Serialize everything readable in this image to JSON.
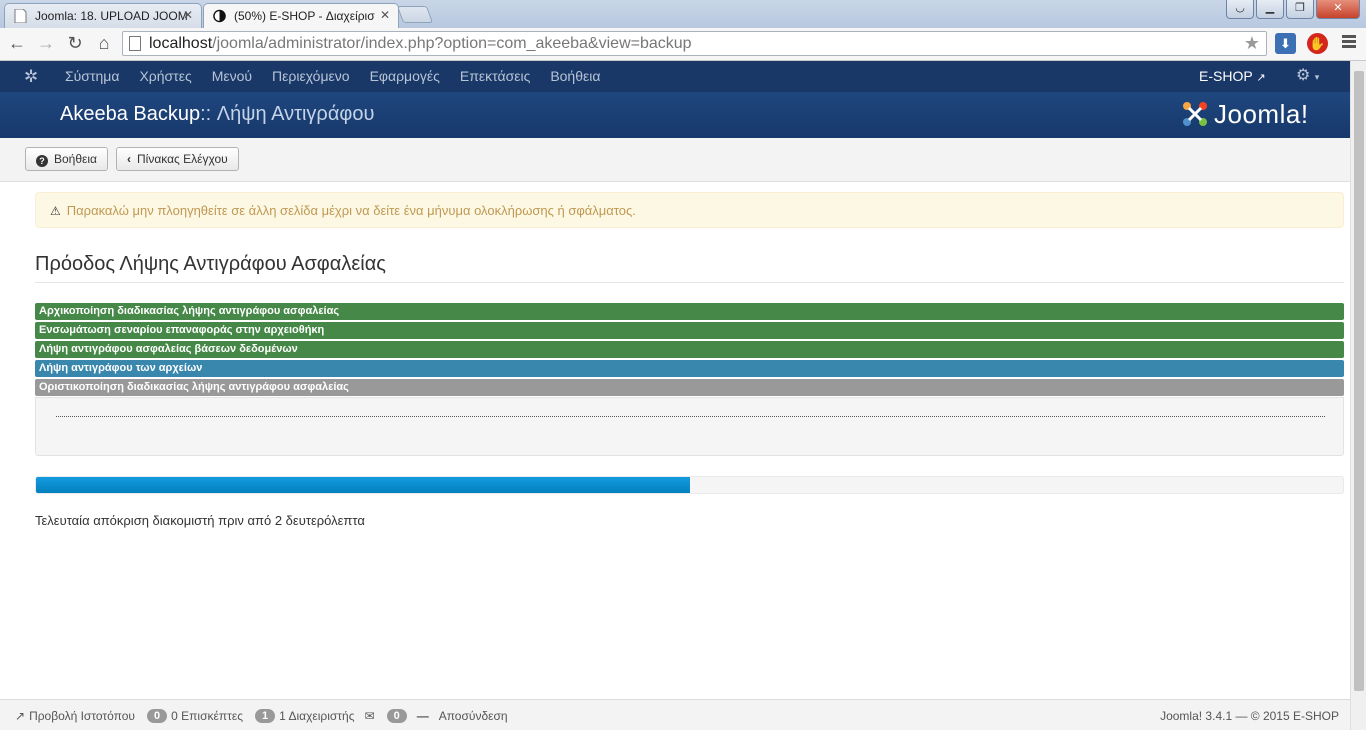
{
  "browser": {
    "tabs": [
      {
        "title": "Joomla: 18. UPLOAD JOOM",
        "icon": "page-icon"
      },
      {
        "title": "(50%) E-SHOP - Διαχείρισ",
        "icon": "half-circle-icon"
      }
    ],
    "url_host": "localhost",
    "url_path": "/joomla/administrator/index.php?option=com_akeeba&view=backup"
  },
  "admin_nav": {
    "menu": [
      "Σύστημα",
      "Χρήστες",
      "Μενού",
      "Περιεχόμενο",
      "Εφαρμογές",
      "Επεκτάσεις",
      "Βοήθεια"
    ],
    "site_name": "E-SHOP"
  },
  "header": {
    "title_main": "Akeeba Backup",
    "title_sep": "::",
    "title_sub": "Λήψη Αντιγράφου",
    "logo_text": "Joomla!"
  },
  "toolbar": {
    "help_label": "Βοήθεια",
    "control_panel_label": "Πίνακας Ελέγχου"
  },
  "warning": "Παρακαλώ μην πλοηγηθείτε σε άλλη σελίδα μέχρι να δείτε ένα μήνυμα ολοκλήρωσης ή σφάλματος.",
  "progress_heading": "Πρόοδος Λήψης Αντιγράφου Ασφαλείας",
  "steps": [
    {
      "label": "Αρχικοποίηση διαδικασίας λήψης αντιγράφου ασφαλείας",
      "status": "done"
    },
    {
      "label": "Ενσωμάτωση σεναρίου επαναφοράς στην αρχειοθήκη",
      "status": "done"
    },
    {
      "label": "Λήψη αντιγράφου ασφαλείας βάσεων δεδομένων",
      "status": "done"
    },
    {
      "label": "Λήψη αντιγράφου των αρχείων",
      "status": "active"
    },
    {
      "label": "Οριστικοποίηση διαδικασίας λήψης αντιγράφου ασφαλείας",
      "status": "pending"
    }
  ],
  "progress_percent": 50,
  "last_response": "Τελευταία απόκριση διακομιστή πριν από 2 δευτερόλεπτα",
  "footer": {
    "view_site": "Προβολή Ιστοτόπου",
    "visitors_count": "0",
    "visitors_label": "0 Επισκέπτες",
    "admins_count": "1",
    "admins_label": "1 Διαχειριστής",
    "messages_count": "0",
    "logout": "Αποσύνδεση",
    "version": "Joomla! 3.4.1  —  © 2015 E-SHOP"
  }
}
